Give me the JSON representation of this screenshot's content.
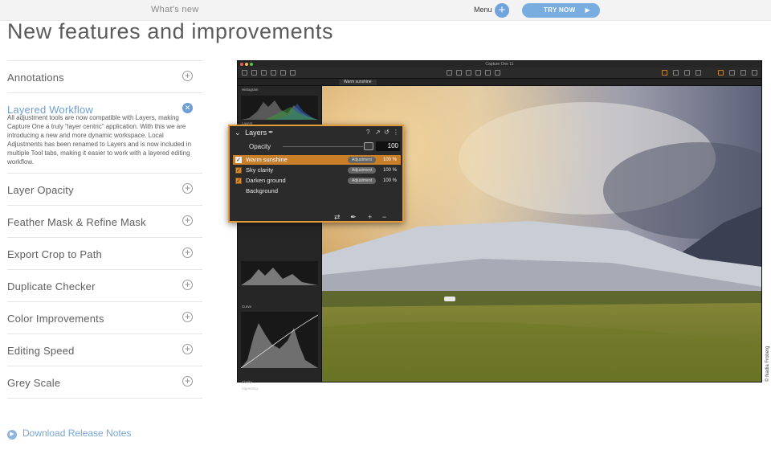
{
  "topbar": {
    "whats_new": "What's new",
    "menu_label": "Menu",
    "try_now": "TRY NOW"
  },
  "page": {
    "title": "New features and improvements"
  },
  "accordion": {
    "items": [
      {
        "title": "Annotations"
      },
      {
        "title": "Layered Workflow",
        "body": "All adjustment tools are now compatible with Layers, making Capture One a truly “layer centric” application. With this we are introducing a new and more dynamic workspace. Local Adjustments has been renamed to Layers and is now included in multiple Tool tabs, making it easier to work with a layered editing workflow."
      },
      {
        "title": "Layer Opacity"
      },
      {
        "title": "Feather Mask & Refine Mask"
      },
      {
        "title": "Export Crop to Path"
      },
      {
        "title": "Duplicate Checker"
      },
      {
        "title": "Color Improvements"
      },
      {
        "title": "Editing Speed"
      },
      {
        "title": "Grey Scale"
      }
    ]
  },
  "download": {
    "label": "Download Release Notes"
  },
  "app": {
    "window_title": "Capture One 11",
    "variant_tab": "Warm sunshine",
    "panels": {
      "histogram": "Histogram",
      "layers": "Layers",
      "curve": "Curve",
      "clarity": "Clarity",
      "vignetting": "Vignetting"
    }
  },
  "layers_panel": {
    "title": "Layers",
    "opacity_label": "Opacity",
    "opacity_value": "100",
    "rows": [
      {
        "name": "Warm sunshine",
        "badge": "Adjustment",
        "pct": "100 %",
        "checked": true,
        "selected": true
      },
      {
        "name": "Sky clarity",
        "badge": "Adjustment",
        "pct": "100 %",
        "checked": true,
        "selected": false
      },
      {
        "name": "Darken ground",
        "badge": "Adjustment",
        "pct": "100 %",
        "checked": true,
        "selected": false
      },
      {
        "name": "Background",
        "badge": "",
        "pct": "",
        "checked": false,
        "selected": false
      }
    ]
  },
  "credit": "© Nadia Froberg",
  "colors": {
    "accent": "#6d9ed4",
    "try_button": "#79acdf",
    "selection": "#c97e28"
  }
}
